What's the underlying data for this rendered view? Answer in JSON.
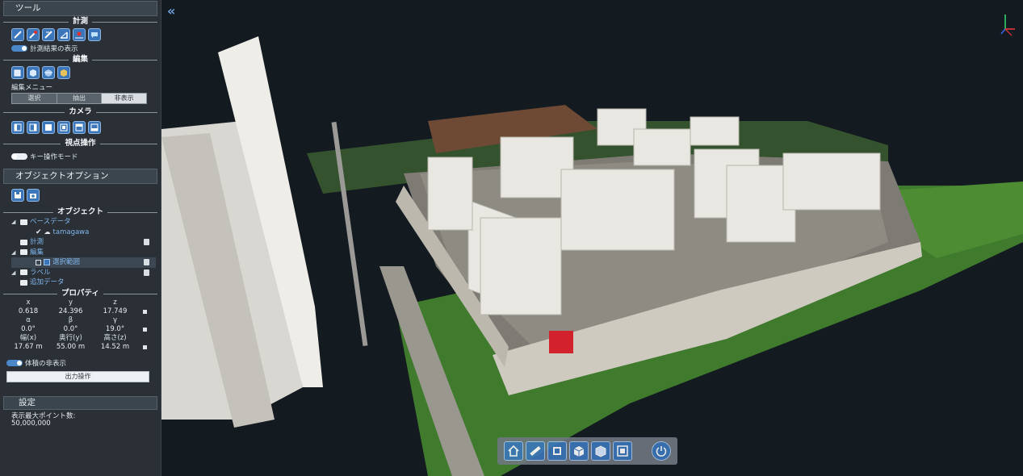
{
  "sidebar": {
    "tools_title": "ツール",
    "measure": {
      "title": "計測",
      "icons": [
        "distance-icon",
        "area-icon",
        "height-icon",
        "angle-icon",
        "point-icon",
        "comment-icon"
      ],
      "show_results_label": "計測結果の表示"
    },
    "edit": {
      "title": "編集",
      "icons": [
        "select-box-icon",
        "clip-box-icon",
        "clip-polygon-icon",
        "clip-plane-icon"
      ],
      "menu_label": "編集メニュー",
      "segments": [
        "選択",
        "抽出",
        "非表示"
      ]
    },
    "camera": {
      "title": "カメラ",
      "icons": [
        "left-view-icon",
        "right-view-icon",
        "front-view-icon",
        "back-view-icon",
        "top-view-icon",
        "bottom-view-icon"
      ]
    },
    "viewpoint": {
      "title": "視点操作",
      "key_mode_label": "キー操作モード"
    },
    "object_options_title": "オブジェクトオプション",
    "object_option_icons": [
      "save-icon",
      "camera-icon"
    ],
    "objects": {
      "title": "オブジェクト",
      "tree": [
        {
          "label": "ベースデータ"
        },
        {
          "label": "tamagawa"
        },
        {
          "label": "計測"
        },
        {
          "label": "編集"
        },
        {
          "label": "選択範囲"
        },
        {
          "label": "ラベル"
        },
        {
          "label": "追加データ"
        }
      ]
    },
    "properties": {
      "title": "プロパティ",
      "headers1": [
        "x",
        "y",
        "z"
      ],
      "values1": [
        "0.618",
        "24.396",
        "17.749"
      ],
      "headers2": [
        "α",
        "β",
        "γ"
      ],
      "values2": [
        "0.0°",
        "0.0°",
        "19.0°"
      ],
      "headers3": [
        "幅(x)",
        "奥行(y)",
        "高さ(z)"
      ],
      "values3": [
        "17.67 m",
        "55.00 m",
        "14.52 m"
      ]
    },
    "hide_volume_label": "体積の非表示",
    "output_button": "出力操作",
    "settings": {
      "title": "設定",
      "max_points_label": "表示最大ポイント数:",
      "max_points_value": "50,000,000"
    }
  },
  "viewport": {
    "collapse_icon": "«",
    "bottom_bar_icons": [
      "home-icon",
      "measure-ruler-icon",
      "fit-icon",
      "box-view-icon",
      "perspective-icon",
      "ortho-icon",
      "power-icon"
    ]
  }
}
